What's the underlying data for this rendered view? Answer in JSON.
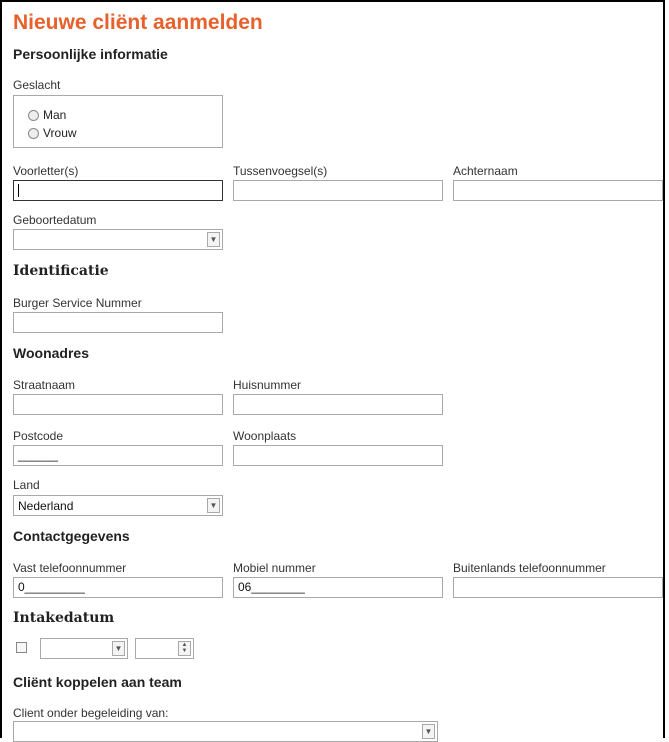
{
  "page": {
    "title": "Nieuwe cliënt aanmelden"
  },
  "personal": {
    "heading": "Persoonlijke informatie",
    "gender_label": "Geslacht",
    "gender_options": [
      "Man",
      "Vrouw"
    ],
    "initials_label": "Voorletter(s)",
    "infix_label": "Tussenvoegsel(s)",
    "lastname_label": "Achternaam",
    "birthdate_label": "Geboortedatum"
  },
  "identification": {
    "heading": "Identificatie",
    "bsn_label": "Burger Service Nummer"
  },
  "address": {
    "heading": "Woonadres",
    "street_label": "Straatnaam",
    "housenumber_label": "Huisnummer",
    "postcode_label": "Postcode",
    "postcode_value": "______",
    "city_label": "Woonplaats",
    "country_label": "Land",
    "country_value": "Nederland"
  },
  "contact": {
    "heading": "Contactgegevens",
    "landline_label": "Vast telefoonnummer",
    "landline_value": "0_________",
    "mobile_label": "Mobiel nummer",
    "mobile_value": "06________",
    "foreign_label": "Buitenlands telefoonnummer"
  },
  "intake": {
    "heading": "Intakedatum"
  },
  "team": {
    "heading": "Cliënt koppelen aan team",
    "supervision_label": "Client onder begeleiding van:"
  },
  "icons": {
    "dropdown": "chevron-down-icon",
    "spinner": "up-down-spinner-icon"
  },
  "colors": {
    "title": "#e8612c"
  }
}
